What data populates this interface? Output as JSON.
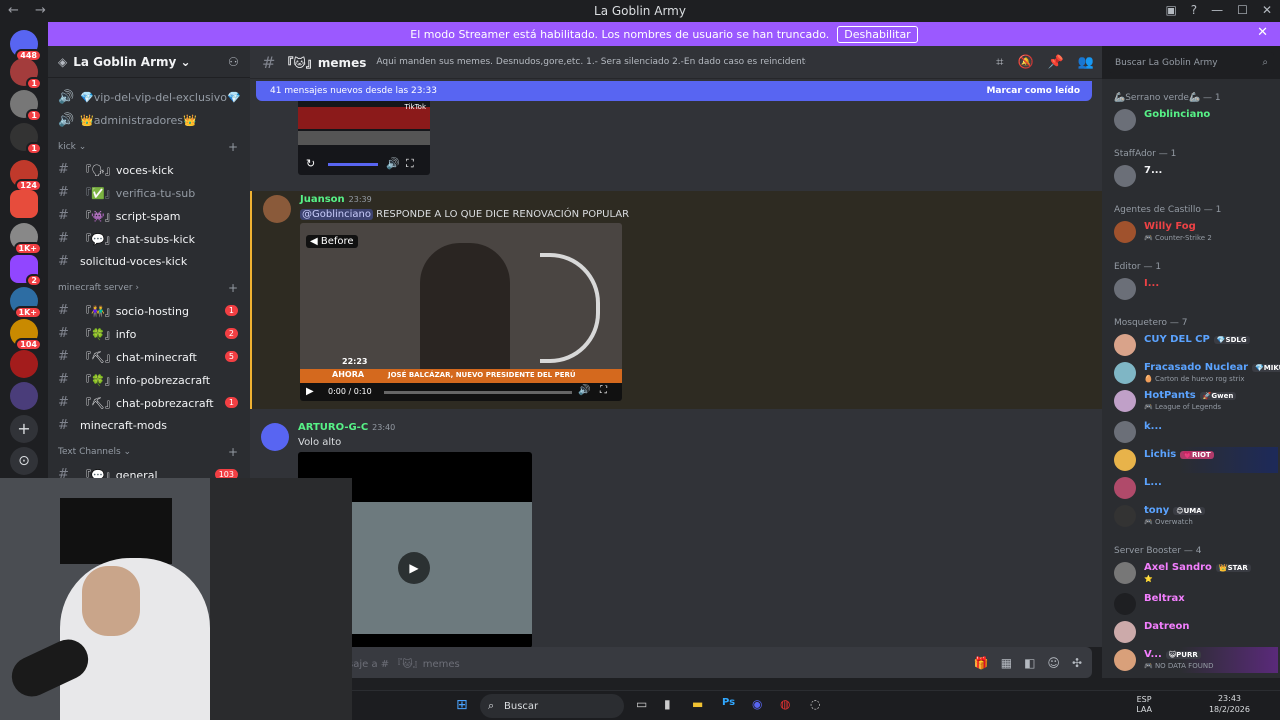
{
  "window": {
    "title": "La Goblin Army"
  },
  "banner": {
    "text": "El modo Streamer está habilitado. Los nombres de usuario se han truncado.",
    "button": "Deshabilitar"
  },
  "guilds": {
    "badges": [
      "448",
      "1",
      "1",
      "1",
      "124",
      "1K+",
      "2",
      "1K+",
      "104"
    ]
  },
  "server": {
    "name": "La Goblin Army ⌄"
  },
  "channels": {
    "top": [
      {
        "label": "💎vip-del-vip-del-exclusivo💎"
      },
      {
        "label": "👑administradores👑"
      }
    ],
    "cat1": "kick ⌄",
    "kick": [
      {
        "label": "『🗣』voces-kick"
      },
      {
        "label": "『✅』verifica-tu-sub"
      },
      {
        "label": "『👾』script-spam"
      },
      {
        "label": "『💬』chat-subs-kick"
      },
      {
        "label": "solicitud-voces-kick"
      }
    ],
    "cat2": "minecraft server ›",
    "minecraft": [
      {
        "label": "『👫』socio-hosting",
        "count": "1"
      },
      {
        "label": "『🍀』info",
        "count": "2"
      },
      {
        "label": "『⛏』chat-minecraft",
        "count": "5"
      },
      {
        "label": "『🍀』info-pobrezacraft",
        "count": ""
      },
      {
        "label": "『⛏』chat-pobrezacraft",
        "count": "1"
      },
      {
        "label": "minecraft-mods",
        "count": ""
      }
    ],
    "cat3": "Text Channels ⌄",
    "general": {
      "label": "『💬』general",
      "count": "103"
    }
  },
  "topbar": {
    "channel": "『🐱』memes",
    "topic": "Aqui manden sus memes. Desnudos,gore,etc. 1.- Sera silenciado 2.-En dado caso es reincidente sera baneado",
    "search_placeholder": "Buscar La Goblin Army"
  },
  "newbar": {
    "text": "41 mensajes nuevos desde las 23:33",
    "mark": "Marcar como leído"
  },
  "messages": [
    {
      "user": "Juanson",
      "time": "23:39",
      "mention": "@Goblinciano",
      "text": " RESPONDE A LO QUE DICE RENOVACIÓN POPULAR",
      "video": {
        "before": "◀ Before",
        "time": "0:00 / 0:10",
        "lower": "JOSÉ BALCÁZAR, NUEVO PRESIDENTE DEL PERÚ",
        "clock": "22:23",
        "ahora": "AHORA"
      }
    },
    {
      "user": "ARTURO-G-C",
      "time": "23:40",
      "text": "Volo alto"
    }
  ],
  "prev_video": {
    "tiktok": "TikTok"
  },
  "composer": {
    "placeholder": "saje a # 『🐱』memes"
  },
  "members": {
    "roles": [
      {
        "label": "🦾Serrano verde🦾 — 1"
      },
      {
        "label": "StaffAdor — 1"
      },
      {
        "label": "Agentes de Castillo — 1"
      },
      {
        "label": "Editor — 1"
      },
      {
        "label": "Mosquetero — 7"
      },
      {
        "label": "Server Booster — 4"
      }
    ],
    "list": [
      {
        "name": "Goblinciano",
        "color": "#57f287",
        "sub": ""
      },
      {
        "name": "7...",
        "color": "#f2f3f5",
        "sub": ""
      },
      {
        "name": "Willy Fog",
        "color": "#ed4245",
        "sub": "🎮 Counter-Strike 2"
      },
      {
        "name": "I...",
        "color": "#ed4245",
        "sub": ""
      },
      {
        "name": "CUY DEL CP",
        "color": "#5ba3ff",
        "tag": "💎SDLG",
        "sub": ""
      },
      {
        "name": "Fracasado Nuclear",
        "color": "#5ba3ff",
        "tag": "💎MIKU",
        "sub": "🥚 Carton de huevo rog strix"
      },
      {
        "name": "HotPants",
        "color": "#5ba3ff",
        "tag": "🚀Gwen",
        "sub": "🎮 League of Legends"
      },
      {
        "name": "k...",
        "color": "#5ba3ff",
        "sub": ""
      },
      {
        "name": "Lichis",
        "color": "#5ba3ff",
        "tag": "💗RIOT",
        "sub": ""
      },
      {
        "name": "L...",
        "color": "#5ba3ff",
        "sub": ""
      },
      {
        "name": "tony",
        "color": "#5ba3ff",
        "tag": "😊UMA",
        "sub": "🎮 Overwatch"
      },
      {
        "name": "Axel Sandro",
        "color": "#f47fff",
        "tag": "👑STAR",
        "sub": "⭐"
      },
      {
        "name": "Beltrax",
        "color": "#f47fff",
        "sub": ""
      },
      {
        "name": "Datreon",
        "color": "#f47fff",
        "sub": ""
      },
      {
        "name": "V...",
        "color": "#f47fff",
        "tag": "😺PURR",
        "sub": "🎮 NO DATA FOUND"
      }
    ]
  },
  "taskbar": {
    "search": "Buscar",
    "lang1": "ESP",
    "lang2": "LAA",
    "time": "23:43",
    "date": "18/2/2026"
  }
}
